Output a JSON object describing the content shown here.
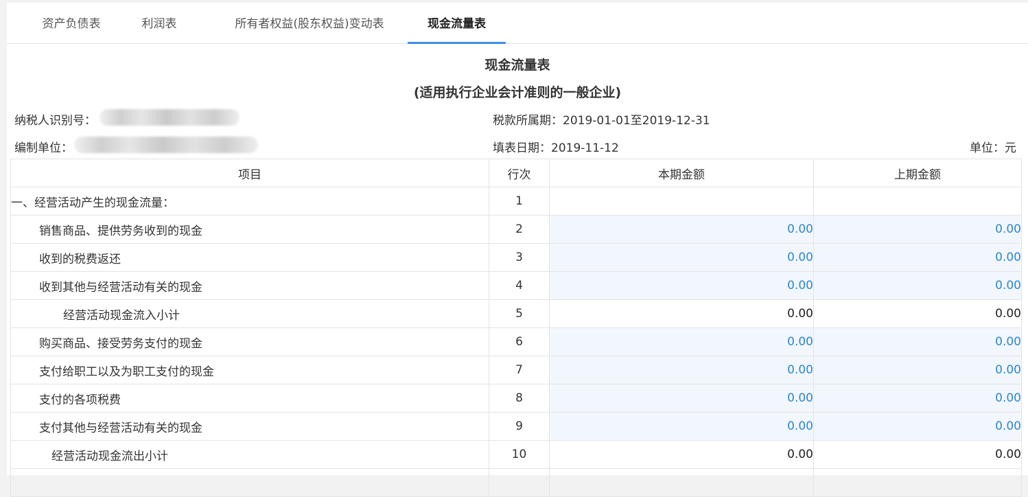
{
  "tabs": [
    {
      "label": "资产负债表"
    },
    {
      "label": "利润表"
    },
    {
      "label": "所有者权益(股东权益)变动表"
    },
    {
      "label": "现金流量表"
    }
  ],
  "report": {
    "title": "现金流量表",
    "subtitle": "(适用执行企业会计准则的一般企业)",
    "taxpayer_id_label": "纳税人识别号：",
    "company_label": "编制单位：",
    "period_label": "税款所属期：2019-01-01至2019-12-31",
    "fill_date_label": "填表日期：2019-11-12",
    "unit_label": "单位：元"
  },
  "table": {
    "headers": [
      "项目",
      "行次",
      "本期金额",
      "上期金额"
    ],
    "rows": [
      {
        "item": "一、经营活动产生的现金流量：",
        "line": "1",
        "current": "",
        "previous": ""
      },
      {
        "item": "销售商品、提供劳务收到的现金",
        "line": "2",
        "current": "0.00",
        "previous": "0.00"
      },
      {
        "item": "收到的税费返还",
        "line": "3",
        "current": "0.00",
        "previous": "0.00"
      },
      {
        "item": "收到其他与经营活动有关的现金",
        "line": "4",
        "current": "0.00",
        "previous": "0.00"
      },
      {
        "item": "经营活动现金流入小计",
        "line": "5",
        "current": "0.00",
        "previous": "0.00"
      },
      {
        "item": "购买商品、接受劳务支付的现金",
        "line": "6",
        "current": "0.00",
        "previous": "0.00"
      },
      {
        "item": "支付给职工以及为职工支付的现金",
        "line": "7",
        "current": "0.00",
        "previous": "0.00"
      },
      {
        "item": "支付的各项税费",
        "line": "8",
        "current": "0.00",
        "previous": "0.00"
      },
      {
        "item": "支付其他与经营活动有关的现金",
        "line": "9",
        "current": "0.00",
        "previous": "0.00"
      },
      {
        "item": "经营活动现金流出小计",
        "line": "10",
        "current": "0.00",
        "previous": "0.00"
      }
    ]
  },
  "colors": {
    "active_tab_underline": "#3d8ee8",
    "editable_cell_bg": "#f1f7fd",
    "editable_value": "#2f86cf"
  }
}
